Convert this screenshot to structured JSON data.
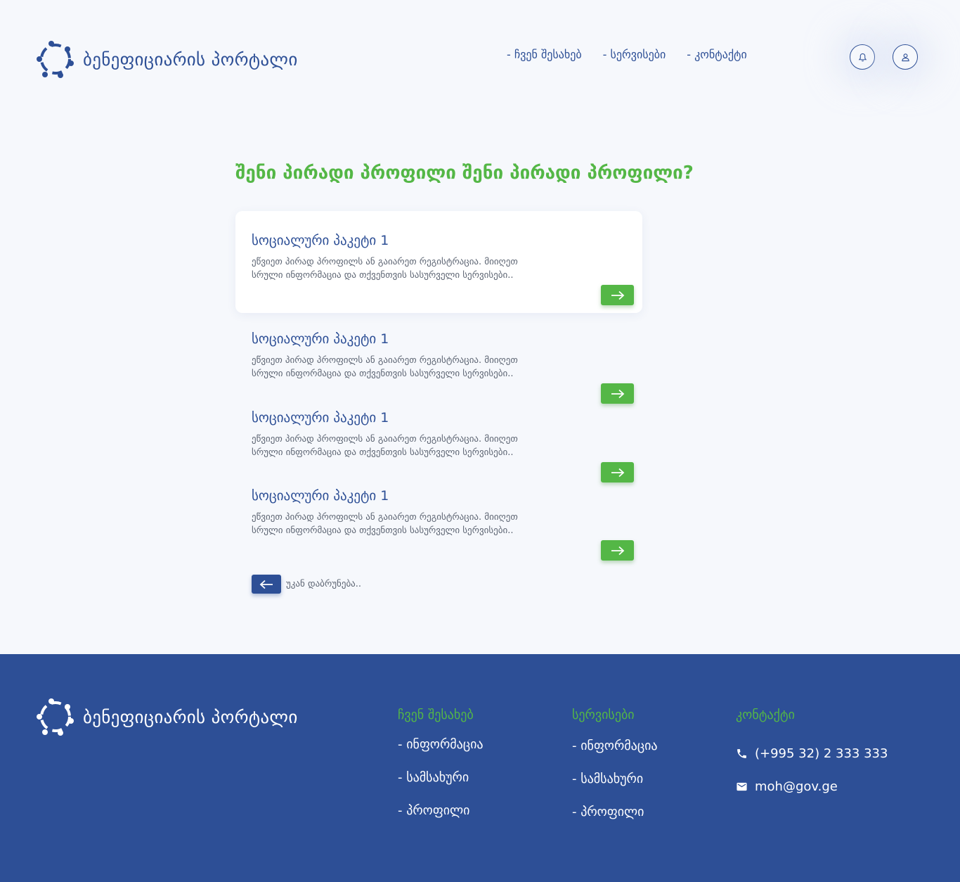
{
  "header": {
    "logo_text": "ბენეფიციარის პორტალი",
    "nav": [
      "- ჩვენ შესახებ",
      "- სერვისები",
      "- კონტაქტი"
    ],
    "icons": [
      "bell-icon",
      "user-icon"
    ]
  },
  "main": {
    "title": "შენი პირადი პროფილი შენი პირადი პროფილი?",
    "cards": [
      {
        "title": "სოციალური პაკეტი 1",
        "description": "ეწვიეთ პირად პროფილს ან გაიარეთ რეგისტრაცია. მიიღეთ სრული ინფორმაცია და თქვენთვის სასურველი სერვისები..",
        "active": true
      },
      {
        "title": "სოციალური პაკეტი 1",
        "description": "ეწვიეთ პირად პროფილს ან გაიარეთ რეგისტრაცია. მიიღეთ სრული ინფორმაცია და თქვენთვის სასურველი სერვისები..",
        "active": false
      },
      {
        "title": "სოციალური პაკეტი 1",
        "description": "ეწვიეთ პირად პროფილს ან გაიარეთ რეგისტრაცია. მიიღეთ სრული ინფორმაცია და თქვენთვის სასურველი სერვისები..",
        "active": false
      },
      {
        "title": "სოციალური პაკეტი 1",
        "description": "ეწვიეთ პირად პროფილს ან გაიარეთ რეგისტრაცია. მიიღეთ სრული ინფორმაცია და თქვენთვის სასურველი სერვისები..",
        "active": false
      }
    ],
    "back_label": "უკან დაბრუნება.."
  },
  "footer": {
    "logo_text": "ბენეფიციარის პორტალი",
    "col_about": {
      "title": "ჩვენ შესახებ",
      "links": [
        "- ინფორმაცია",
        "- სამსახური",
        "- პროფილი"
      ]
    },
    "col_services": {
      "title": "სერვისები",
      "links": [
        "- ინფორმაცია",
        "- სამსახური",
        "- პროფილი"
      ]
    },
    "col_contact": {
      "title": "კონტაქტი",
      "phone": "(+995 32) 2 333 333",
      "email": "moh@gov.ge"
    }
  },
  "colors": {
    "primary": "#2d4f96",
    "accent": "#54b746",
    "background": "#f6f8fc"
  }
}
